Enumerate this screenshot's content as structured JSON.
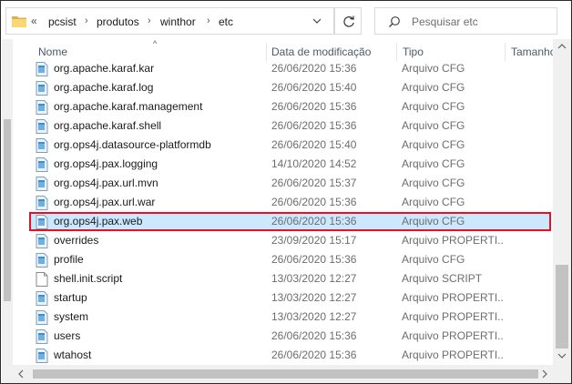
{
  "address": {
    "overflow": "«",
    "crumbs": [
      "pcsist",
      "produtos",
      "winthor",
      "etc"
    ]
  },
  "search": {
    "placeholder": "Pesquisar etc"
  },
  "columns": {
    "name": "Nome",
    "date": "Data de modificação",
    "type": "Tipo",
    "size": "Tamanho"
  },
  "files": [
    {
      "name": "org.apache.karaf.kar",
      "date": "26/06/2020 15:36",
      "type": "Arquivo CFG",
      "icon": "cfg-file-icon"
    },
    {
      "name": "org.apache.karaf.log",
      "date": "26/06/2020 15:40",
      "type": "Arquivo CFG",
      "icon": "cfg-file-icon"
    },
    {
      "name": "org.apache.karaf.management",
      "date": "26/06/2020 15:36",
      "type": "Arquivo CFG",
      "icon": "cfg-file-icon"
    },
    {
      "name": "org.apache.karaf.shell",
      "date": "26/06/2020 15:36",
      "type": "Arquivo CFG",
      "icon": "cfg-file-icon"
    },
    {
      "name": "org.ops4j.datasource-platformdb",
      "date": "26/06/2020 15:40",
      "type": "Arquivo CFG",
      "icon": "cfg-file-icon"
    },
    {
      "name": "org.ops4j.pax.logging",
      "date": "14/10/2020 14:52",
      "type": "Arquivo CFG",
      "icon": "cfg-file-icon"
    },
    {
      "name": "org.ops4j.pax.url.mvn",
      "date": "26/06/2020 15:37",
      "type": "Arquivo CFG",
      "icon": "cfg-file-icon"
    },
    {
      "name": "org.ops4j.pax.url.war",
      "date": "26/06/2020 15:36",
      "type": "Arquivo CFG",
      "icon": "cfg-file-icon"
    },
    {
      "name": "org.ops4j.pax.web",
      "date": "26/06/2020 15:36",
      "type": "Arquivo CFG",
      "icon": "cfg-file-icon",
      "selected": true
    },
    {
      "name": "overrides",
      "date": "23/09/2020 15:17",
      "type": "Arquivo PROPERTI...",
      "icon": "properties-file-icon"
    },
    {
      "name": "profile",
      "date": "26/06/2020 15:36",
      "type": "Arquivo CFG",
      "icon": "cfg-file-icon"
    },
    {
      "name": "shell.init.script",
      "date": "13/03/2020 12:27",
      "type": "Arquivo SCRIPT",
      "icon": "script-file-icon"
    },
    {
      "name": "startup",
      "date": "13/03/2020 12:27",
      "type": "Arquivo PROPERTI...",
      "icon": "properties-file-icon"
    },
    {
      "name": "system",
      "date": "13/03/2020 12:27",
      "type": "Arquivo PROPERTI...",
      "icon": "properties-file-icon"
    },
    {
      "name": "users",
      "date": "26/06/2020 15:36",
      "type": "Arquivo PROPERTI...",
      "icon": "properties-file-icon"
    },
    {
      "name": "wtahost",
      "date": "26/06/2020 15:36",
      "type": "Arquivo PROPERTI...",
      "icon": "properties-file-icon"
    }
  ],
  "colors": {
    "selection_bg": "#cce8ff",
    "highlight_border": "#e81123",
    "folder": "#f8d775"
  }
}
